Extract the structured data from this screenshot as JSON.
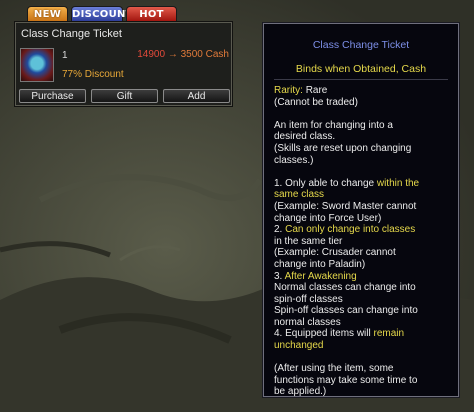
{
  "tabs": [
    {
      "label": "NEW"
    },
    {
      "label": "DISCOUNT"
    },
    {
      "label": "HOT"
    }
  ],
  "item": {
    "name": "Class Change Ticket",
    "quantity": "1",
    "old_price": "14900",
    "arrow": "→",
    "new_price": "3500 Cash",
    "discount": "77% Discount",
    "buttons": {
      "purchase": "Purchase",
      "gift": "Gift",
      "add": "Add"
    }
  },
  "tooltip": {
    "title": "Class Change Ticket",
    "bind": "Binds when Obtained, Cash",
    "rarity_label": "Rarity:",
    "rarity_value": "Rare",
    "trade": "(Cannot be traded)",
    "desc": [
      "An item for changing into a",
      "desired class.",
      "(Skills are reset upon changing",
      "classes.)"
    ],
    "r1_a": "1. Only able to change ",
    "r1_b": "within the",
    "r1_c": "same class",
    "r1_ex1": "(Example: Sword Master cannot",
    "r1_ex2": "change into Force User)",
    "r2_a": "2. ",
    "r2_b": "Can only change into classes",
    "r2_c": "in the same tier",
    "r2_ex1": "(Example: Crusader cannot",
    "r2_ex2": "change into Paladin)",
    "r3_a": "3. ",
    "r3_b": "After Awakening",
    "r3_l1": "Normal classes can change into",
    "r3_l2": "spin-off classes",
    "r3_l3": "Spin-off classes can change into",
    "r3_l4": "normal classes",
    "r4_a": "4. Equipped items will ",
    "r4_b": "remain",
    "r4_c": "unchanged",
    "note": [
      "(After using the item, some",
      "functions may take some time to",
      "be applied.)"
    ]
  },
  "colors": {
    "accent_yellow": "#e6d94b",
    "title_blue": "#7d8fe8",
    "price_red": "#e24a3a",
    "discount_orange": "#e8a838"
  },
  "icons": {
    "item": "ticket-icon"
  }
}
